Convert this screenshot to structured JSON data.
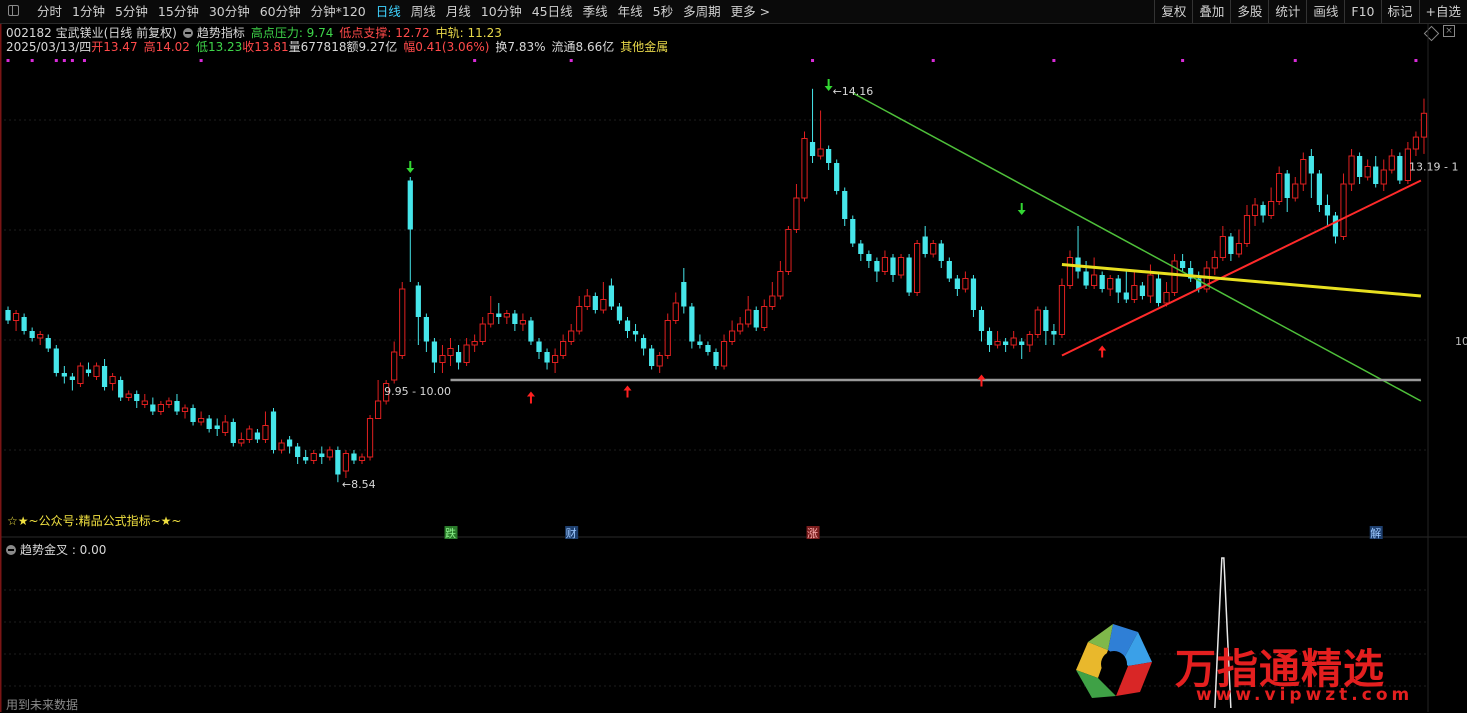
{
  "toolbar": {
    "tabs": [
      "分时",
      "1分钟",
      "5分钟",
      "15分钟",
      "30分钟",
      "60分钟",
      "分钟*120",
      "日线",
      "周线",
      "月线",
      "10分钟",
      "45日线",
      "季线",
      "年线",
      "5秒",
      "多周期",
      "更多 >"
    ],
    "active_tab": "日线",
    "right_buttons": [
      "复权",
      "叠加",
      "多股",
      "统计",
      "画线",
      "F10",
      "标记",
      "+自选"
    ]
  },
  "stock": {
    "title": "002182 宝武镁业(日线 前复权)",
    "indicator_name": "趋势指标",
    "high_pressure_label": "高点压力: 9.74",
    "low_support_label": "低点支撑: 12.72",
    "mid_rail_label": "中轨: 11.23",
    "date": "2025/03/13/四",
    "open": "开13.47",
    "high": "高14.02",
    "low": "低13.23",
    "close": "收13.81",
    "volume": "量677818",
    "amount": "额9.27亿",
    "change": "幅0.41(3.06%)",
    "turnover": "换7.83%",
    "float_cap": "流通8.66亿",
    "sector": "其他金属"
  },
  "annotations": {
    "peak": "14.16",
    "trough": "8.54",
    "support_range": "9.95 - 10.00",
    "right_range": "13.19 - 1",
    "right_axis": "10",
    "brand_text": "☆★~公众号:精品公式指标~★~",
    "event_tags": [
      "跌",
      "财",
      "涨",
      "解"
    ]
  },
  "sub_panel": {
    "label": "趋势金叉 : 0.00",
    "footer": "用到未来数据"
  },
  "watermark": {
    "text": "万指通精选",
    "url": "www.vipwzt.com"
  },
  "colors": {
    "up": "#e02020",
    "down": "#46e6ea",
    "accent": "#3fd3ff",
    "trend_red": "#ff2a2a",
    "trend_green": "#4ec03a",
    "trend_yellow": "#e8e020",
    "support_gray": "#9a9a9a",
    "marker_magenta": "#d82bd8",
    "arrow_green": "#32d732",
    "arrow_red": "#ff2020"
  },
  "chart_data": {
    "type": "candlestick",
    "ylim": [
      8.0,
      14.6
    ],
    "candles": [
      {
        "o": 11.0,
        "c": 10.85,
        "h": 11.05,
        "l": 10.8
      },
      {
        "o": 10.85,
        "c": 10.95,
        "h": 11.0,
        "l": 10.7
      },
      {
        "o": 10.9,
        "c": 10.7,
        "h": 10.95,
        "l": 10.65
      },
      {
        "o": 10.7,
        "c": 10.6,
        "h": 10.75,
        "l": 10.55
      },
      {
        "o": 10.6,
        "c": 10.65,
        "h": 10.7,
        "l": 10.5
      },
      {
        "o": 10.6,
        "c": 10.45,
        "h": 10.65,
        "l": 10.4
      },
      {
        "o": 10.45,
        "c": 10.1,
        "h": 10.5,
        "l": 10.05
      },
      {
        "o": 10.1,
        "c": 10.05,
        "h": 10.2,
        "l": 9.95
      },
      {
        "o": 10.05,
        "c": 10.0,
        "h": 10.1,
        "l": 9.85
      },
      {
        "o": 9.95,
        "c": 10.2,
        "h": 10.25,
        "l": 9.9
      },
      {
        "o": 10.15,
        "c": 10.1,
        "h": 10.25,
        "l": 10.05
      },
      {
        "o": 10.05,
        "c": 10.2,
        "h": 10.25,
        "l": 10.0
      },
      {
        "o": 10.2,
        "c": 9.9,
        "h": 10.3,
        "l": 9.85
      },
      {
        "o": 9.95,
        "c": 10.05,
        "h": 10.1,
        "l": 9.85
      },
      {
        "o": 10.0,
        "c": 9.75,
        "h": 10.05,
        "l": 9.7
      },
      {
        "o": 9.75,
        "c": 9.8,
        "h": 9.85,
        "l": 9.7
      },
      {
        "o": 9.8,
        "c": 9.7,
        "h": 9.85,
        "l": 9.6
      },
      {
        "o": 9.65,
        "c": 9.7,
        "h": 9.8,
        "l": 9.6
      },
      {
        "o": 9.65,
        "c": 9.55,
        "h": 9.75,
        "l": 9.5
      },
      {
        "o": 9.55,
        "c": 9.65,
        "h": 9.7,
        "l": 9.5
      },
      {
        "o": 9.65,
        "c": 9.7,
        "h": 9.75,
        "l": 9.6
      },
      {
        "o": 9.7,
        "c": 9.55,
        "h": 9.8,
        "l": 9.5
      },
      {
        "o": 9.55,
        "c": 9.6,
        "h": 9.65,
        "l": 9.45
      },
      {
        "o": 9.6,
        "c": 9.4,
        "h": 9.65,
        "l": 9.35
      },
      {
        "o": 9.4,
        "c": 9.45,
        "h": 9.55,
        "l": 9.35
      },
      {
        "o": 9.45,
        "c": 9.3,
        "h": 9.5,
        "l": 9.25
      },
      {
        "o": 9.35,
        "c": 9.3,
        "h": 9.45,
        "l": 9.2
      },
      {
        "o": 9.25,
        "c": 9.4,
        "h": 9.5,
        "l": 9.2
      },
      {
        "o": 9.4,
        "c": 9.1,
        "h": 9.45,
        "l": 9.05
      },
      {
        "o": 9.1,
        "c": 9.15,
        "h": 9.25,
        "l": 9.05
      },
      {
        "o": 9.15,
        "c": 9.3,
        "h": 9.35,
        "l": 9.1
      },
      {
        "o": 9.25,
        "c": 9.15,
        "h": 9.3,
        "l": 9.1
      },
      {
        "o": 9.15,
        "c": 9.35,
        "h": 9.55,
        "l": 9.1
      },
      {
        "o": 9.55,
        "c": 9.0,
        "h": 9.6,
        "l": 8.95
      },
      {
        "o": 9.0,
        "c": 9.1,
        "h": 9.15,
        "l": 8.95
      },
      {
        "o": 9.15,
        "c": 9.05,
        "h": 9.2,
        "l": 8.95
      },
      {
        "o": 9.05,
        "c": 8.9,
        "h": 9.1,
        "l": 8.8
      },
      {
        "o": 8.9,
        "c": 8.85,
        "h": 9.0,
        "l": 8.8
      },
      {
        "o": 8.85,
        "c": 8.95,
        "h": 9.0,
        "l": 8.8
      },
      {
        "o": 8.95,
        "c": 8.9,
        "h": 9.05,
        "l": 8.8
      },
      {
        "o": 8.9,
        "c": 9.0,
        "h": 9.05,
        "l": 8.85
      },
      {
        "o": 9.0,
        "c": 8.65,
        "h": 9.05,
        "l": 8.54
      },
      {
        "o": 8.7,
        "c": 8.95,
        "h": 9.0,
        "l": 8.6
      },
      {
        "o": 8.95,
        "c": 8.85,
        "h": 9.0,
        "l": 8.8
      },
      {
        "o": 8.85,
        "c": 8.9,
        "h": 8.95,
        "l": 8.8
      },
      {
        "o": 8.9,
        "c": 9.45,
        "h": 9.5,
        "l": 8.85
      },
      {
        "o": 9.45,
        "c": 9.7,
        "h": 10.0,
        "l": 9.45
      },
      {
        "o": 9.7,
        "c": 9.95,
        "h": 10.0,
        "l": 9.65
      },
      {
        "o": 10.0,
        "c": 10.4,
        "h": 10.55,
        "l": 9.95
      },
      {
        "o": 10.35,
        "c": 11.3,
        "h": 11.4,
        "l": 10.3
      },
      {
        "o": 12.85,
        "c": 12.15,
        "h": 12.9,
        "l": 11.4
      },
      {
        "o": 11.35,
        "c": 10.9,
        "h": 11.4,
        "l": 10.5
      },
      {
        "o": 10.9,
        "c": 10.55,
        "h": 10.95,
        "l": 10.4
      },
      {
        "o": 10.55,
        "c": 10.25,
        "h": 10.6,
        "l": 10.1
      },
      {
        "o": 10.25,
        "c": 10.35,
        "h": 10.5,
        "l": 10.1
      },
      {
        "o": 10.35,
        "c": 10.45,
        "h": 10.6,
        "l": 10.2
      },
      {
        "o": 10.4,
        "c": 10.25,
        "h": 10.5,
        "l": 10.15
      },
      {
        "o": 10.25,
        "c": 10.5,
        "h": 10.6,
        "l": 10.2
      },
      {
        "o": 10.5,
        "c": 10.55,
        "h": 10.65,
        "l": 10.4
      },
      {
        "o": 10.55,
        "c": 10.8,
        "h": 10.9,
        "l": 10.5
      },
      {
        "o": 10.8,
        "c": 10.95,
        "h": 11.2,
        "l": 10.75
      },
      {
        "o": 10.95,
        "c": 10.9,
        "h": 11.1,
        "l": 10.8
      },
      {
        "o": 10.9,
        "c": 10.95,
        "h": 11.0,
        "l": 10.8
      },
      {
        "o": 10.95,
        "c": 10.8,
        "h": 11.0,
        "l": 10.7
      },
      {
        "o": 10.8,
        "c": 10.85,
        "h": 10.95,
        "l": 10.7
      },
      {
        "o": 10.85,
        "c": 10.55,
        "h": 10.9,
        "l": 10.5
      },
      {
        "o": 10.55,
        "c": 10.4,
        "h": 10.6,
        "l": 10.3
      },
      {
        "o": 10.4,
        "c": 10.25,
        "h": 10.45,
        "l": 10.15
      },
      {
        "o": 10.25,
        "c": 10.35,
        "h": 10.45,
        "l": 10.1
      },
      {
        "o": 10.35,
        "c": 10.55,
        "h": 10.65,
        "l": 10.3
      },
      {
        "o": 10.55,
        "c": 10.7,
        "h": 10.8,
        "l": 10.5
      },
      {
        "o": 10.7,
        "c": 11.05,
        "h": 11.2,
        "l": 10.65
      },
      {
        "o": 11.05,
        "c": 11.2,
        "h": 11.3,
        "l": 11.0
      },
      {
        "o": 11.2,
        "c": 11.0,
        "h": 11.25,
        "l": 10.95
      },
      {
        "o": 11.0,
        "c": 11.15,
        "h": 11.4,
        "l": 10.95
      },
      {
        "o": 11.35,
        "c": 11.05,
        "h": 11.45,
        "l": 11.0
      },
      {
        "o": 11.05,
        "c": 10.85,
        "h": 11.1,
        "l": 10.8
      },
      {
        "o": 10.85,
        "c": 10.7,
        "h": 10.9,
        "l": 10.6
      },
      {
        "o": 10.7,
        "c": 10.65,
        "h": 10.8,
        "l": 10.55
      },
      {
        "o": 10.6,
        "c": 10.45,
        "h": 10.65,
        "l": 10.35
      },
      {
        "o": 10.45,
        "c": 10.2,
        "h": 10.5,
        "l": 10.15
      },
      {
        "o": 10.2,
        "c": 10.35,
        "h": 10.4,
        "l": 10.1
      },
      {
        "o": 10.35,
        "c": 10.85,
        "h": 10.95,
        "l": 10.3
      },
      {
        "o": 10.85,
        "c": 11.1,
        "h": 11.25,
        "l": 10.8
      },
      {
        "o": 11.4,
        "c": 11.05,
        "h": 11.6,
        "l": 10.95
      },
      {
        "o": 11.05,
        "c": 10.55,
        "h": 11.1,
        "l": 10.45
      },
      {
        "o": 10.55,
        "c": 10.5,
        "h": 10.65,
        "l": 10.45
      },
      {
        "o": 10.5,
        "c": 10.4,
        "h": 10.55,
        "l": 10.35
      },
      {
        "o": 10.4,
        "c": 10.2,
        "h": 10.45,
        "l": 10.15
      },
      {
        "o": 10.2,
        "c": 10.55,
        "h": 10.65,
        "l": 10.15
      },
      {
        "o": 10.55,
        "c": 10.7,
        "h": 10.85,
        "l": 10.5
      },
      {
        "o": 10.7,
        "c": 10.8,
        "h": 10.9,
        "l": 10.65
      },
      {
        "o": 10.8,
        "c": 11.0,
        "h": 11.2,
        "l": 10.75
      },
      {
        "o": 11.0,
        "c": 10.75,
        "h": 11.05,
        "l": 10.7
      },
      {
        "o": 10.75,
        "c": 11.05,
        "h": 11.15,
        "l": 10.7
      },
      {
        "o": 11.05,
        "c": 11.2,
        "h": 11.4,
        "l": 11.0
      },
      {
        "o": 11.2,
        "c": 11.55,
        "h": 11.7,
        "l": 11.15
      },
      {
        "o": 11.55,
        "c": 12.15,
        "h": 12.2,
        "l": 11.5
      },
      {
        "o": 12.15,
        "c": 12.6,
        "h": 12.8,
        "l": 12.1
      },
      {
        "o": 12.6,
        "c": 13.45,
        "h": 13.55,
        "l": 12.55
      },
      {
        "o": 13.4,
        "c": 13.2,
        "h": 14.16,
        "l": 13.1
      },
      {
        "o": 13.2,
        "c": 13.3,
        "h": 13.85,
        "l": 13.15
      },
      {
        "o": 13.3,
        "c": 13.1,
        "h": 13.35,
        "l": 13.0
      },
      {
        "o": 13.1,
        "c": 12.7,
        "h": 13.15,
        "l": 12.65
      },
      {
        "o": 12.7,
        "c": 12.3,
        "h": 12.75,
        "l": 12.2
      },
      {
        "o": 12.3,
        "c": 11.95,
        "h": 12.35,
        "l": 11.9
      },
      {
        "o": 11.95,
        "c": 11.8,
        "h": 12.0,
        "l": 11.7
      },
      {
        "o": 11.8,
        "c": 11.7,
        "h": 11.85,
        "l": 11.6
      },
      {
        "o": 11.7,
        "c": 11.55,
        "h": 11.75,
        "l": 11.4
      },
      {
        "o": 11.55,
        "c": 11.75,
        "h": 11.85,
        "l": 11.5
      },
      {
        "o": 11.75,
        "c": 11.5,
        "h": 11.8,
        "l": 11.4
      },
      {
        "o": 11.5,
        "c": 11.75,
        "h": 11.8,
        "l": 11.45
      },
      {
        "o": 11.75,
        "c": 11.25,
        "h": 11.8,
        "l": 11.2
      },
      {
        "o": 11.25,
        "c": 11.95,
        "h": 12.0,
        "l": 11.2
      },
      {
        "o": 12.05,
        "c": 11.8,
        "h": 12.2,
        "l": 11.75
      },
      {
        "o": 11.8,
        "c": 11.95,
        "h": 12.0,
        "l": 11.75
      },
      {
        "o": 11.95,
        "c": 11.7,
        "h": 12.0,
        "l": 11.6
      },
      {
        "o": 11.7,
        "c": 11.45,
        "h": 11.75,
        "l": 11.4
      },
      {
        "o": 11.45,
        "c": 11.3,
        "h": 11.5,
        "l": 11.2
      },
      {
        "o": 11.3,
        "c": 11.45,
        "h": 11.55,
        "l": 11.25
      },
      {
        "o": 11.45,
        "c": 11.0,
        "h": 11.5,
        "l": 10.9
      },
      {
        "o": 11.0,
        "c": 10.7,
        "h": 11.05,
        "l": 10.55
      },
      {
        "o": 10.7,
        "c": 10.5,
        "h": 10.75,
        "l": 10.4
      },
      {
        "o": 10.5,
        "c": 10.55,
        "h": 10.7,
        "l": 10.45
      },
      {
        "o": 10.55,
        "c": 10.5,
        "h": 10.6,
        "l": 10.4
      },
      {
        "o": 10.5,
        "c": 10.6,
        "h": 10.7,
        "l": 10.45
      },
      {
        "o": 10.55,
        "c": 10.5,
        "h": 10.6,
        "l": 10.3
      },
      {
        "o": 10.5,
        "c": 10.65,
        "h": 10.7,
        "l": 10.4
      },
      {
        "o": 10.65,
        "c": 11.0,
        "h": 11.05,
        "l": 10.6
      },
      {
        "o": 11.0,
        "c": 10.7,
        "h": 11.05,
        "l": 10.5
      },
      {
        "o": 10.7,
        "c": 10.65,
        "h": 10.8,
        "l": 10.5
      },
      {
        "o": 10.65,
        "c": 11.35,
        "h": 11.45,
        "l": 10.6
      },
      {
        "o": 11.35,
        "c": 11.75,
        "h": 11.85,
        "l": 11.3
      },
      {
        "o": 11.75,
        "c": 11.55,
        "h": 12.2,
        "l": 11.45
      },
      {
        "o": 11.55,
        "c": 11.35,
        "h": 11.7,
        "l": 11.3
      },
      {
        "o": 11.35,
        "c": 11.5,
        "h": 11.75,
        "l": 11.3
      },
      {
        "o": 11.5,
        "c": 11.3,
        "h": 11.55,
        "l": 11.25
      },
      {
        "o": 11.3,
        "c": 11.45,
        "h": 11.5,
        "l": 11.2
      },
      {
        "o": 11.45,
        "c": 11.25,
        "h": 11.5,
        "l": 11.1
      },
      {
        "o": 11.25,
        "c": 11.15,
        "h": 11.55,
        "l": 11.1
      },
      {
        "o": 11.15,
        "c": 11.35,
        "h": 11.55,
        "l": 11.1
      },
      {
        "o": 11.35,
        "c": 11.2,
        "h": 11.4,
        "l": 11.15
      },
      {
        "o": 11.2,
        "c": 11.5,
        "h": 11.65,
        "l": 11.1
      },
      {
        "o": 11.45,
        "c": 11.1,
        "h": 11.55,
        "l": 11.05
      },
      {
        "o": 11.1,
        "c": 11.25,
        "h": 11.4,
        "l": 11.05
      },
      {
        "o": 11.25,
        "c": 11.7,
        "h": 11.8,
        "l": 11.2
      },
      {
        "o": 11.7,
        "c": 11.6,
        "h": 11.8,
        "l": 11.55
      },
      {
        "o": 11.6,
        "c": 11.45,
        "h": 11.7,
        "l": 11.4
      },
      {
        "o": 11.45,
        "c": 11.3,
        "h": 11.55,
        "l": 11.25
      },
      {
        "o": 11.3,
        "c": 11.6,
        "h": 11.7,
        "l": 11.25
      },
      {
        "o": 11.6,
        "c": 11.75,
        "h": 11.85,
        "l": 11.5
      },
      {
        "o": 11.75,
        "c": 12.05,
        "h": 12.2,
        "l": 11.7
      },
      {
        "o": 12.05,
        "c": 11.8,
        "h": 12.1,
        "l": 11.7
      },
      {
        "o": 11.8,
        "c": 11.95,
        "h": 12.15,
        "l": 11.75
      },
      {
        "o": 11.95,
        "c": 12.35,
        "h": 12.5,
        "l": 11.9
      },
      {
        "o": 12.35,
        "c": 12.5,
        "h": 12.6,
        "l": 12.2
      },
      {
        "o": 12.5,
        "c": 12.35,
        "h": 12.55,
        "l": 12.25
      },
      {
        "o": 12.35,
        "c": 12.55,
        "h": 12.75,
        "l": 12.3
      },
      {
        "o": 12.55,
        "c": 12.95,
        "h": 13.05,
        "l": 12.5
      },
      {
        "o": 12.95,
        "c": 12.6,
        "h": 13.0,
        "l": 12.4
      },
      {
        "o": 12.6,
        "c": 12.8,
        "h": 12.9,
        "l": 12.55
      },
      {
        "o": 12.8,
        "c": 13.15,
        "h": 13.25,
        "l": 12.7
      },
      {
        "o": 13.2,
        "c": 12.95,
        "h": 13.3,
        "l": 12.6
      },
      {
        "o": 12.95,
        "c": 12.5,
        "h": 13.0,
        "l": 12.4
      },
      {
        "o": 12.5,
        "c": 12.35,
        "h": 12.65,
        "l": 12.2
      },
      {
        "o": 12.35,
        "c": 12.05,
        "h": 12.4,
        "l": 11.95
      },
      {
        "o": 12.05,
        "c": 12.8,
        "h": 12.95,
        "l": 12.0
      },
      {
        "o": 12.8,
        "c": 13.2,
        "h": 13.3,
        "l": 12.7
      },
      {
        "o": 13.2,
        "c": 12.9,
        "h": 13.25,
        "l": 12.8
      },
      {
        "o": 12.9,
        "c": 13.05,
        "h": 13.15,
        "l": 12.85
      },
      {
        "o": 13.05,
        "c": 12.8,
        "h": 13.2,
        "l": 12.75
      },
      {
        "o": 12.8,
        "c": 13.0,
        "h": 13.15,
        "l": 12.7
      },
      {
        "o": 13.0,
        "c": 13.2,
        "h": 13.3,
        "l": 12.95
      },
      {
        "o": 13.2,
        "c": 12.85,
        "h": 13.25,
        "l": 12.8
      },
      {
        "o": 12.85,
        "c": 13.3,
        "h": 13.4,
        "l": 12.8
      },
      {
        "o": 13.3,
        "c": 13.47,
        "h": 13.55,
        "l": 13.2
      },
      {
        "o": 13.47,
        "c": 13.81,
        "h": 14.02,
        "l": 13.23
      }
    ],
    "trend_lines": [
      {
        "name": "red",
        "x0": 131,
        "y0": 10.35,
        "x1": 175,
        "y1": 12.85
      },
      {
        "name": "green",
        "x0": 105,
        "y0": 14.1,
        "x1": 175,
        "y1": 9.7
      },
      {
        "name": "yellow",
        "x0": 131,
        "y0": 11.65,
        "x1": 175,
        "y1": 11.2
      },
      {
        "name": "support",
        "x0": 55,
        "y0": 10.0,
        "x1": 175,
        "y1": 10.0
      }
    ],
    "sub_series": {
      "peak_index": 151,
      "peak_value": 1.0,
      "ylim": [
        0,
        1.0
      ]
    }
  }
}
